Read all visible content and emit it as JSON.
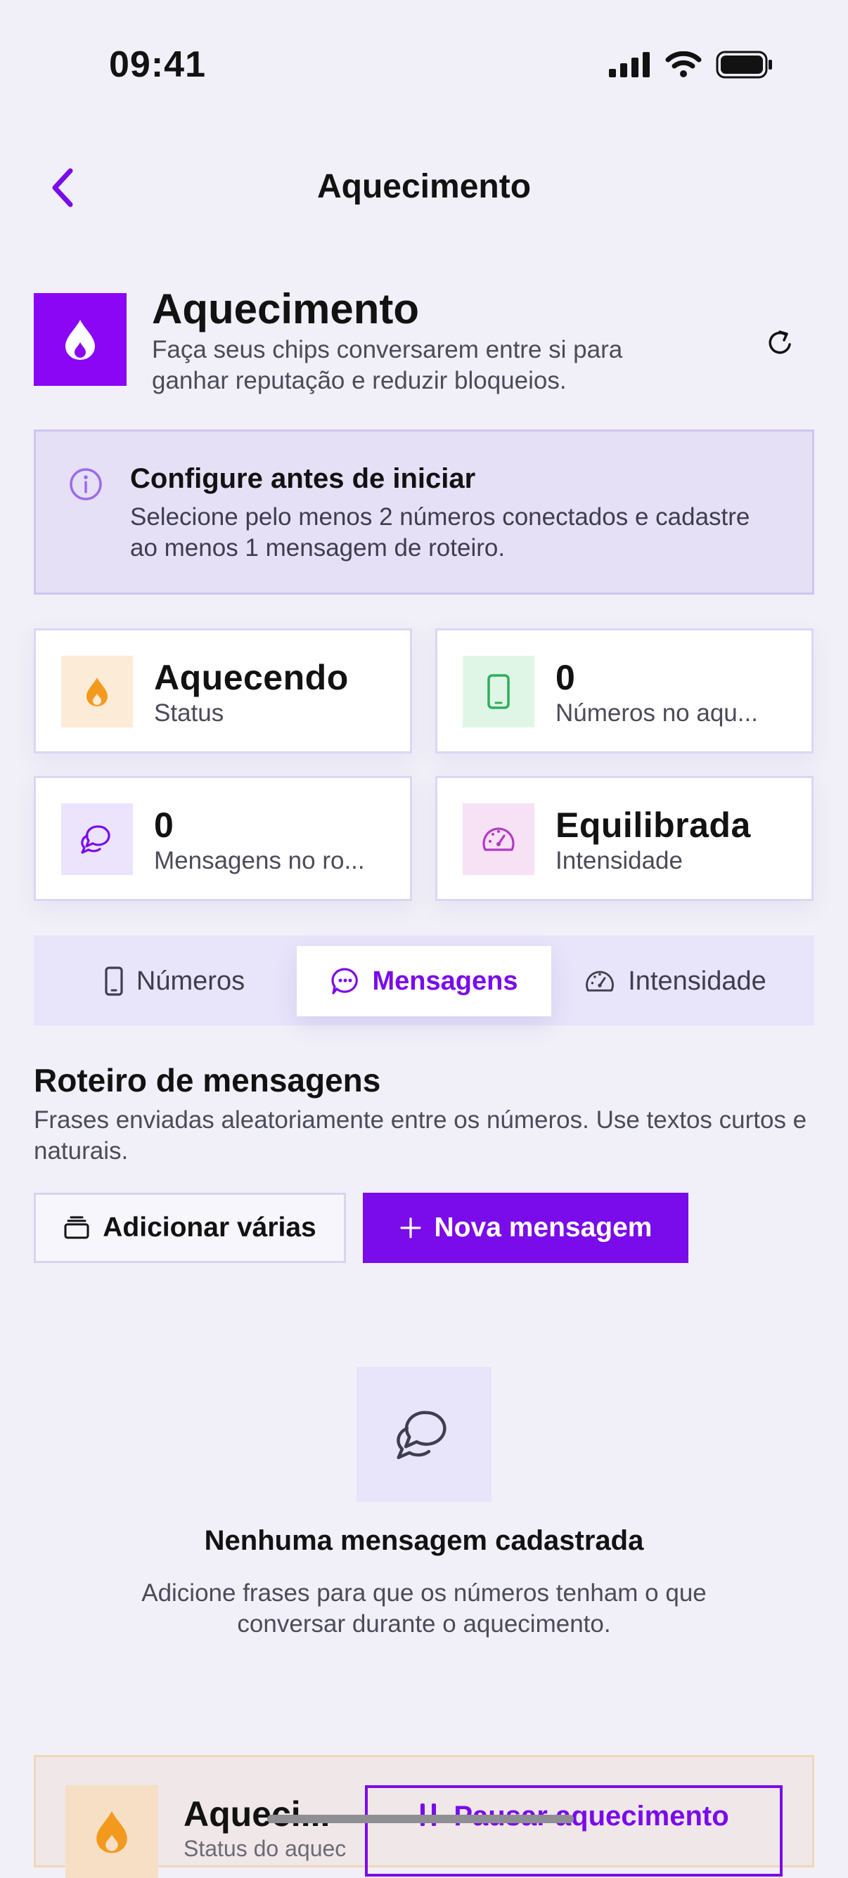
{
  "status_bar": {
    "time": "09:41"
  },
  "nav": {
    "title": "Aquecimento"
  },
  "header": {
    "title": "Aquecimento",
    "subtitle": "Faça seus chips conversarem entre si para ganhar reputação e reduzir bloqueios."
  },
  "info": {
    "title": "Configure antes de iniciar",
    "text": "Selecione pelo menos 2 números conectados e cadastre ao menos 1 mensagem de roteiro."
  },
  "stats": [
    {
      "value": "Aquecendo",
      "label": "Status",
      "icon": "flame-icon"
    },
    {
      "value": "0",
      "label": "Números no aqu...",
      "icon": "phone-icon"
    },
    {
      "value": "0",
      "label": "Mensagens no ro...",
      "icon": "chat-bubbles-icon"
    },
    {
      "value": "Equilibrada",
      "label": "Intensidade",
      "icon": "gauge-icon"
    }
  ],
  "tabs": [
    {
      "label": "Números",
      "active": false
    },
    {
      "label": "Mensagens",
      "active": true
    },
    {
      "label": "Intensidade",
      "active": false
    }
  ],
  "section": {
    "title": "Roteiro de mensagens",
    "description": "Frases enviadas aleatoriamente entre os números. Use textos curtos e naturais.",
    "add_many_label": "Adicionar várias",
    "new_message_label": "Nova mensagem"
  },
  "empty_state": {
    "title": "Nenhuma mensagem cadastrada",
    "text": "Adicione frases para que os números tenham o que conversar durante o aquecimento."
  },
  "bottom_bar": {
    "title": "Aqueci...",
    "subtitle": "Status do aquec",
    "pause_label": "Pausar aquecimento"
  },
  "colors": {
    "accent": "#7A0BEA",
    "background": "#F1F0F8",
    "info_bg": "#E6E0F7",
    "warm": "#F39A1E"
  }
}
